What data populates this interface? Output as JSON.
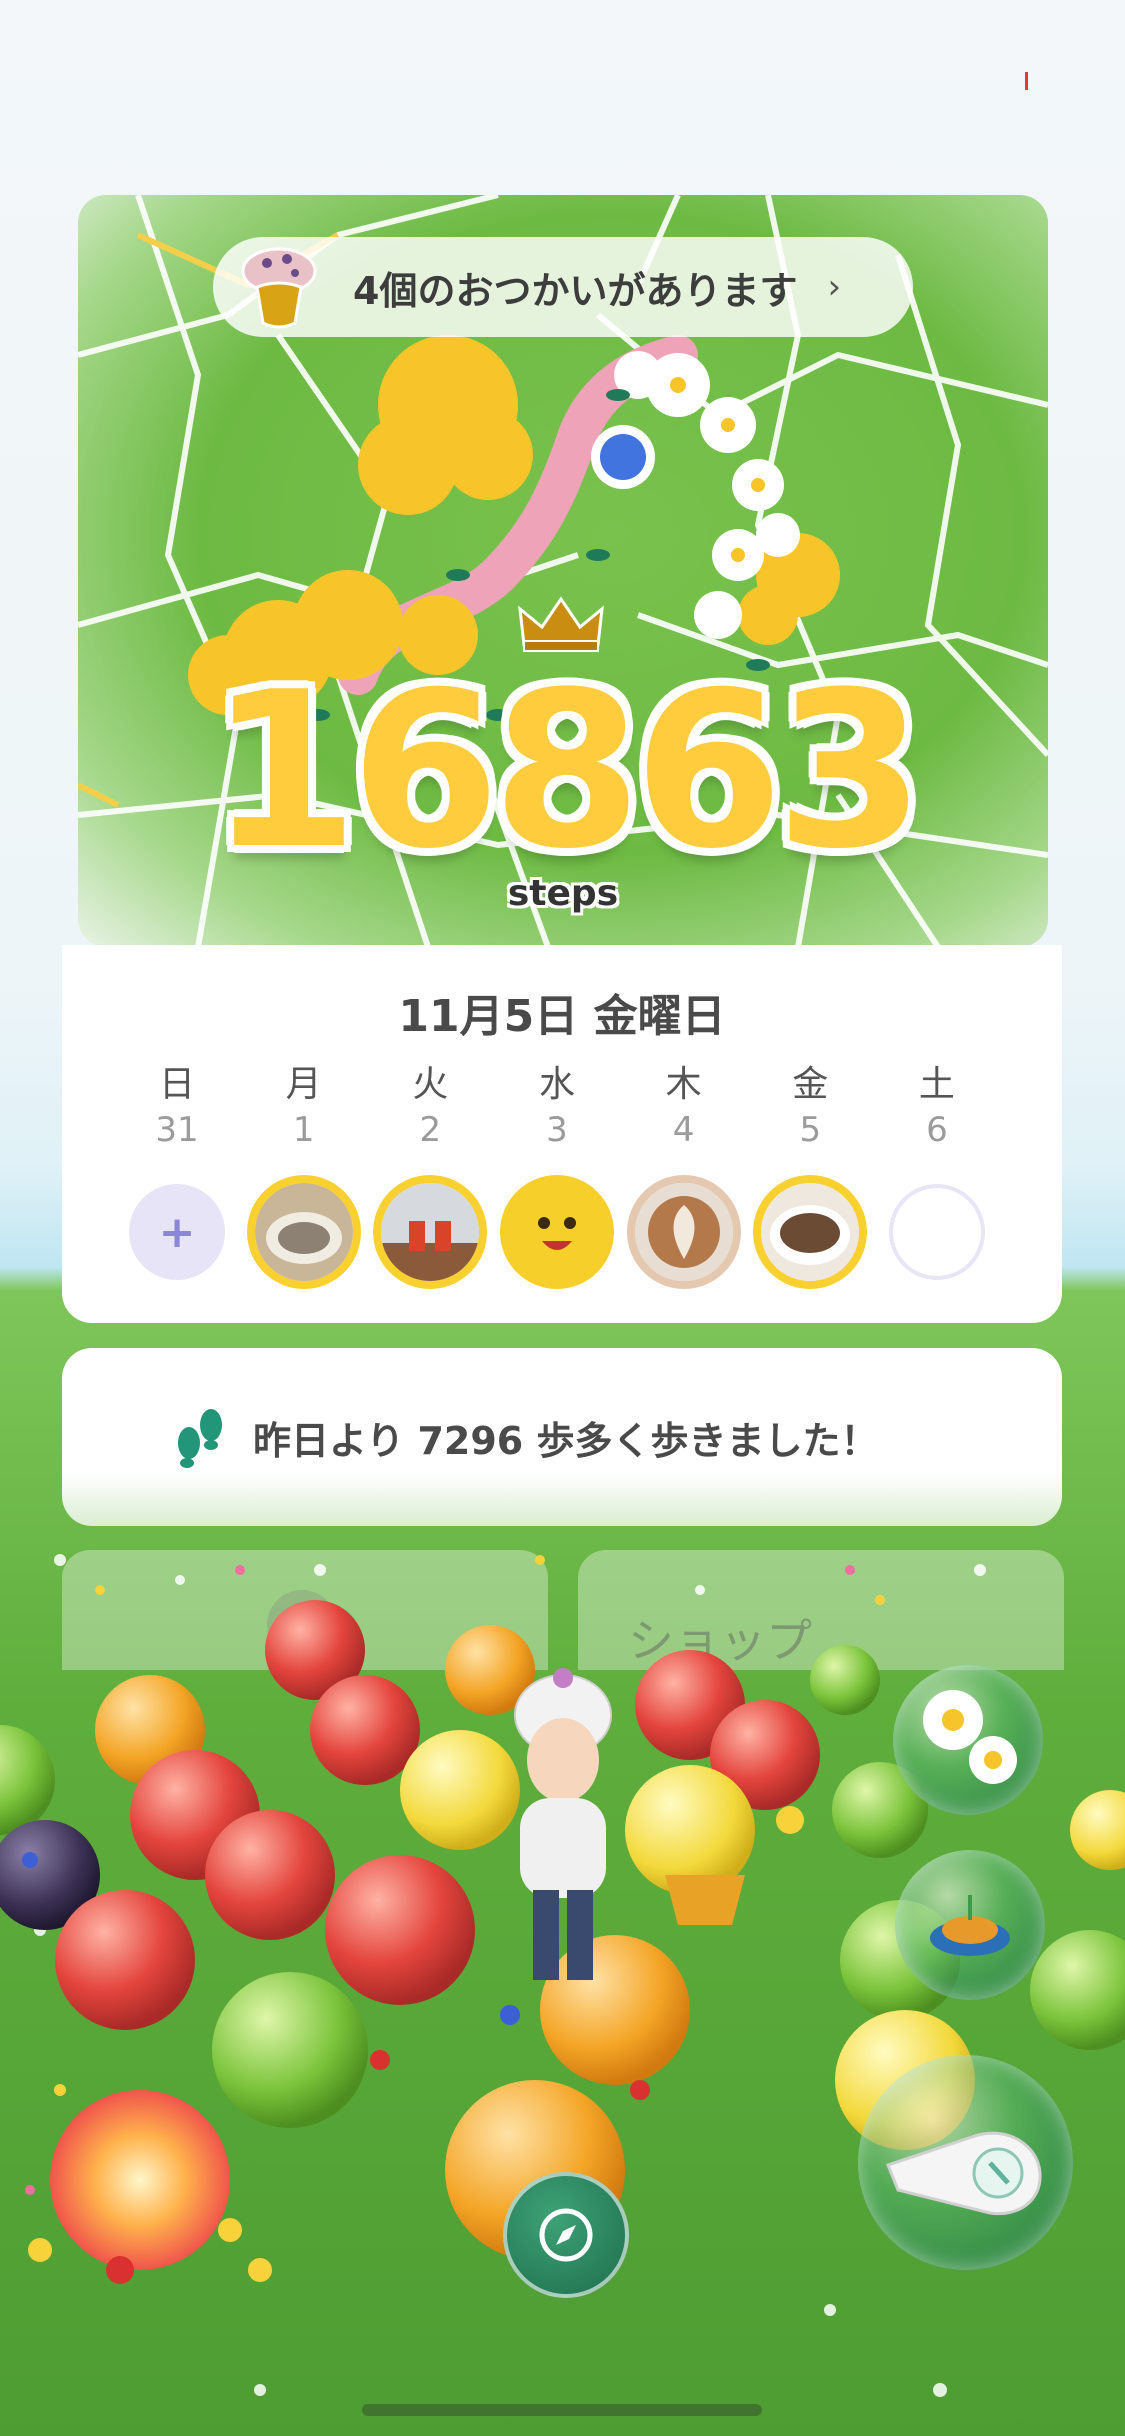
{
  "errand": {
    "label": "4個のおつかいがあります",
    "chevron": "›",
    "icon": "mushroom-icon"
  },
  "steps": {
    "count": "16863",
    "unit": "steps"
  },
  "calendar": {
    "date_title": "11月5日 金曜日",
    "weekdays": [
      "日",
      "月",
      "火",
      "水",
      "木",
      "金",
      "土"
    ],
    "day_numbers": [
      "31",
      "1",
      "2",
      "3",
      "4",
      "5",
      "6"
    ],
    "add_label": "+"
  },
  "comparison": {
    "message": "昨日より 7296 歩多く歩きました！"
  },
  "buttons": {
    "shop_label": "ショップ"
  },
  "colors": {
    "accent_yellow": "#ffcc3d",
    "add_purple": "#8b86d6",
    "map_green": "#6dba43"
  }
}
